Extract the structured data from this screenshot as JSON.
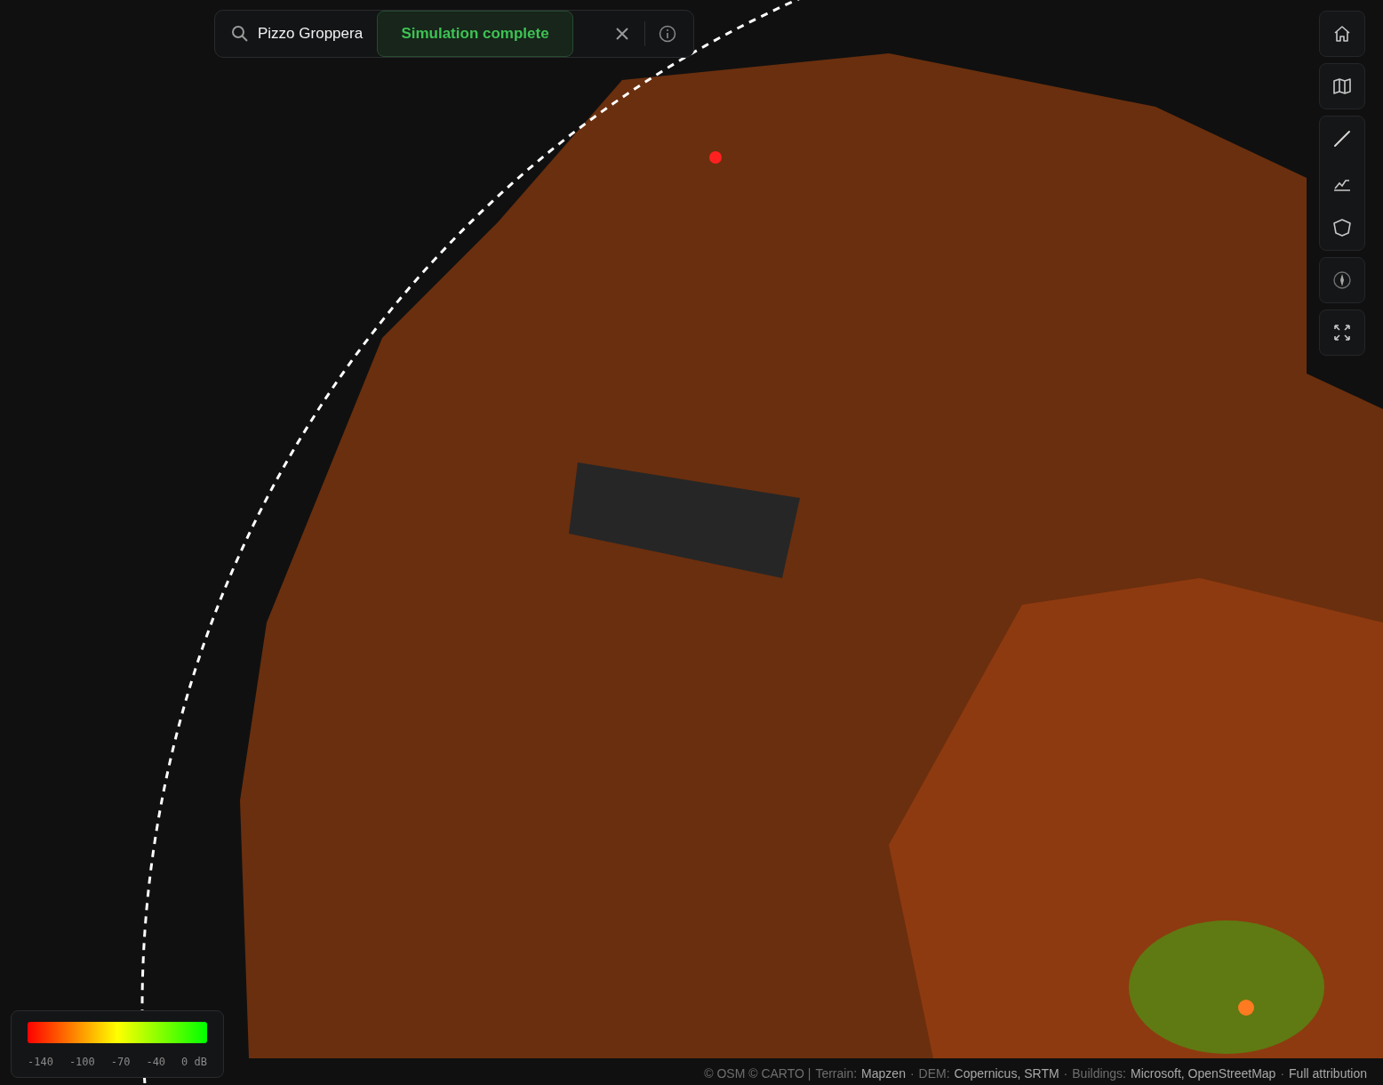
{
  "search": {
    "value": "Pizzo Groppera"
  },
  "toast": {
    "text": "Simulation complete"
  },
  "toolbar": {
    "groups": [
      {
        "buttons": [
          {
            "kind": "home"
          }
        ]
      },
      {
        "buttons": [
          {
            "kind": "map"
          }
        ]
      },
      {
        "buttons": [
          {
            "kind": "line"
          },
          {
            "kind": "profile"
          },
          {
            "kind": "polygon"
          }
        ]
      },
      {
        "buttons": [
          {
            "kind": "compass"
          }
        ]
      },
      {
        "buttons": [
          {
            "kind": "expand"
          }
        ]
      }
    ]
  },
  "legend": {
    "ticks": [
      "-140",
      "-100",
      "-70",
      "-40",
      "0 dB"
    ]
  },
  "attribution": {
    "prefix": "© OSM © CARTO |",
    "sources": [
      {
        "label": "Terrain:",
        "link": "Mapzen"
      },
      {
        "sep": "·",
        "label": "DEM:",
        "link": "Copernicus, SRTM"
      },
      {
        "sep": "·",
        "label": "Buildings:",
        "link": "Microsoft, OpenStreetMap"
      }
    ],
    "sep": "·",
    "full_link": "Full attribution"
  }
}
